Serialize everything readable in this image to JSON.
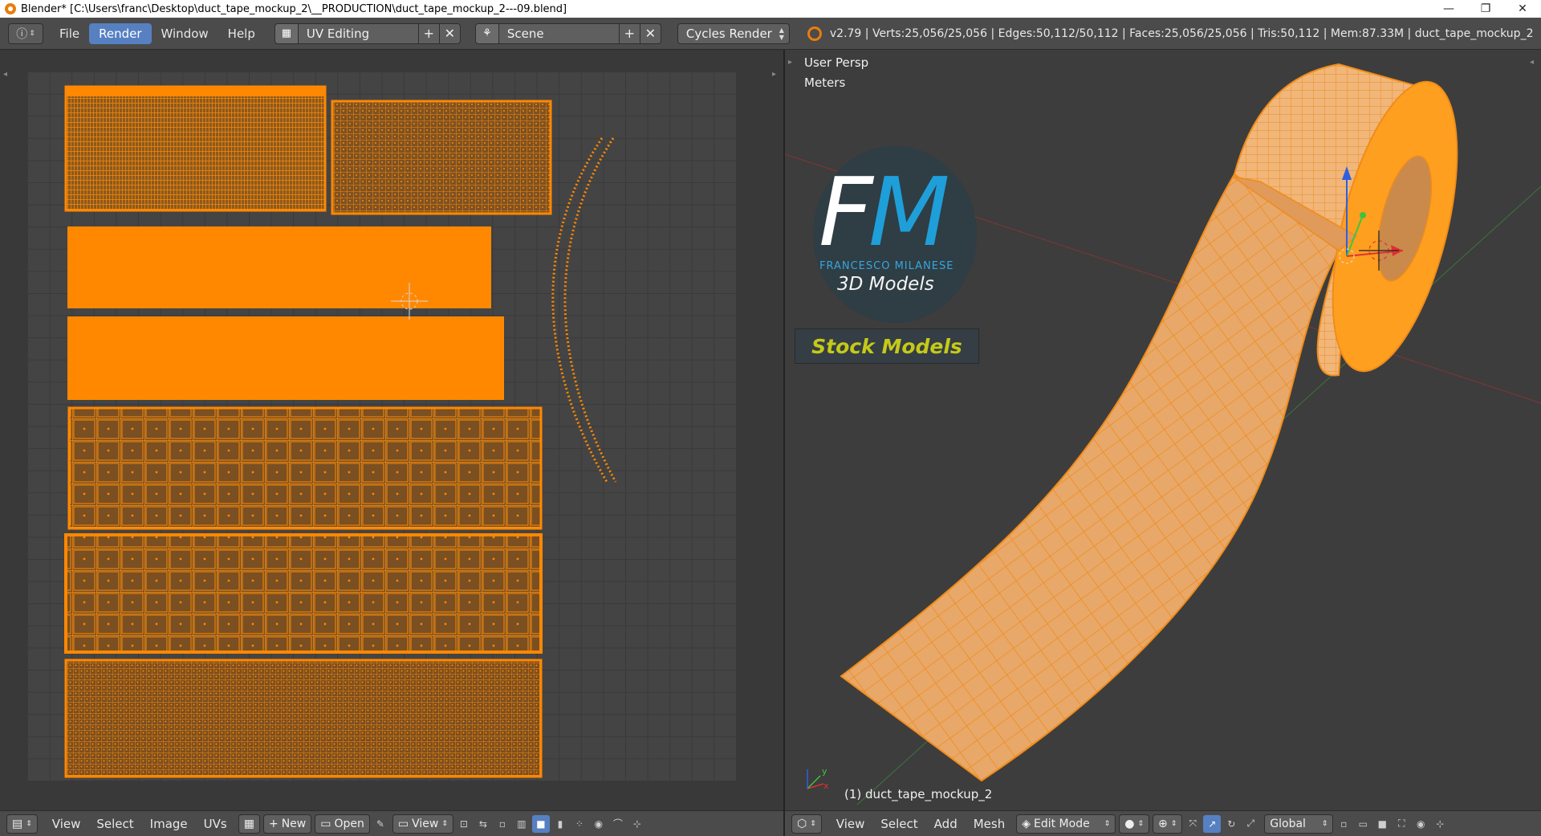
{
  "titlebar": {
    "title": "Blender* [C:\\Users\\franc\\Desktop\\duct_tape_mockup_2\\__PRODUCTION\\duct_tape_mockup_2---09.blend]",
    "minimize": "—",
    "maximize": "❐",
    "close": "✕"
  },
  "info_header": {
    "menus": [
      "File",
      "Render",
      "Window",
      "Help"
    ],
    "active_menu": "Render",
    "screen_layout": "UV Editing",
    "scene": "Scene",
    "render_engine": "Cycles Render",
    "stats": "v2.79 | Verts:25,056/25,056 | Edges:50,112/50,112 | Faces:25,056/25,056 | Tris:50,112 | Mem:87.33M | duct_tape_mockup_2"
  },
  "viewport": {
    "view_name": "User Persp",
    "units": "Meters",
    "object_label": "(1) duct_tape_mockup_2",
    "axis_x": "x",
    "axis_y": "y"
  },
  "logo": {
    "letter_f": "F",
    "letter_m": "M",
    "name": "FRANCESCO MILANESE",
    "subtitle": "3D Models",
    "banner": "Stock Models"
  },
  "uv_bottom": {
    "menus": [
      "View",
      "Select",
      "Image",
      "UVs"
    ],
    "new_label": "New",
    "open_label": "Open",
    "view_label": "View"
  },
  "vp_bottom": {
    "menus": [
      "View",
      "Select",
      "Add",
      "Mesh"
    ],
    "mode": "Edit Mode",
    "orientation": "Global"
  },
  "colors": {
    "uv_orange": "#ff8800",
    "mesh_orange": "#f29a2e",
    "accent_blue": "#5680c2"
  }
}
